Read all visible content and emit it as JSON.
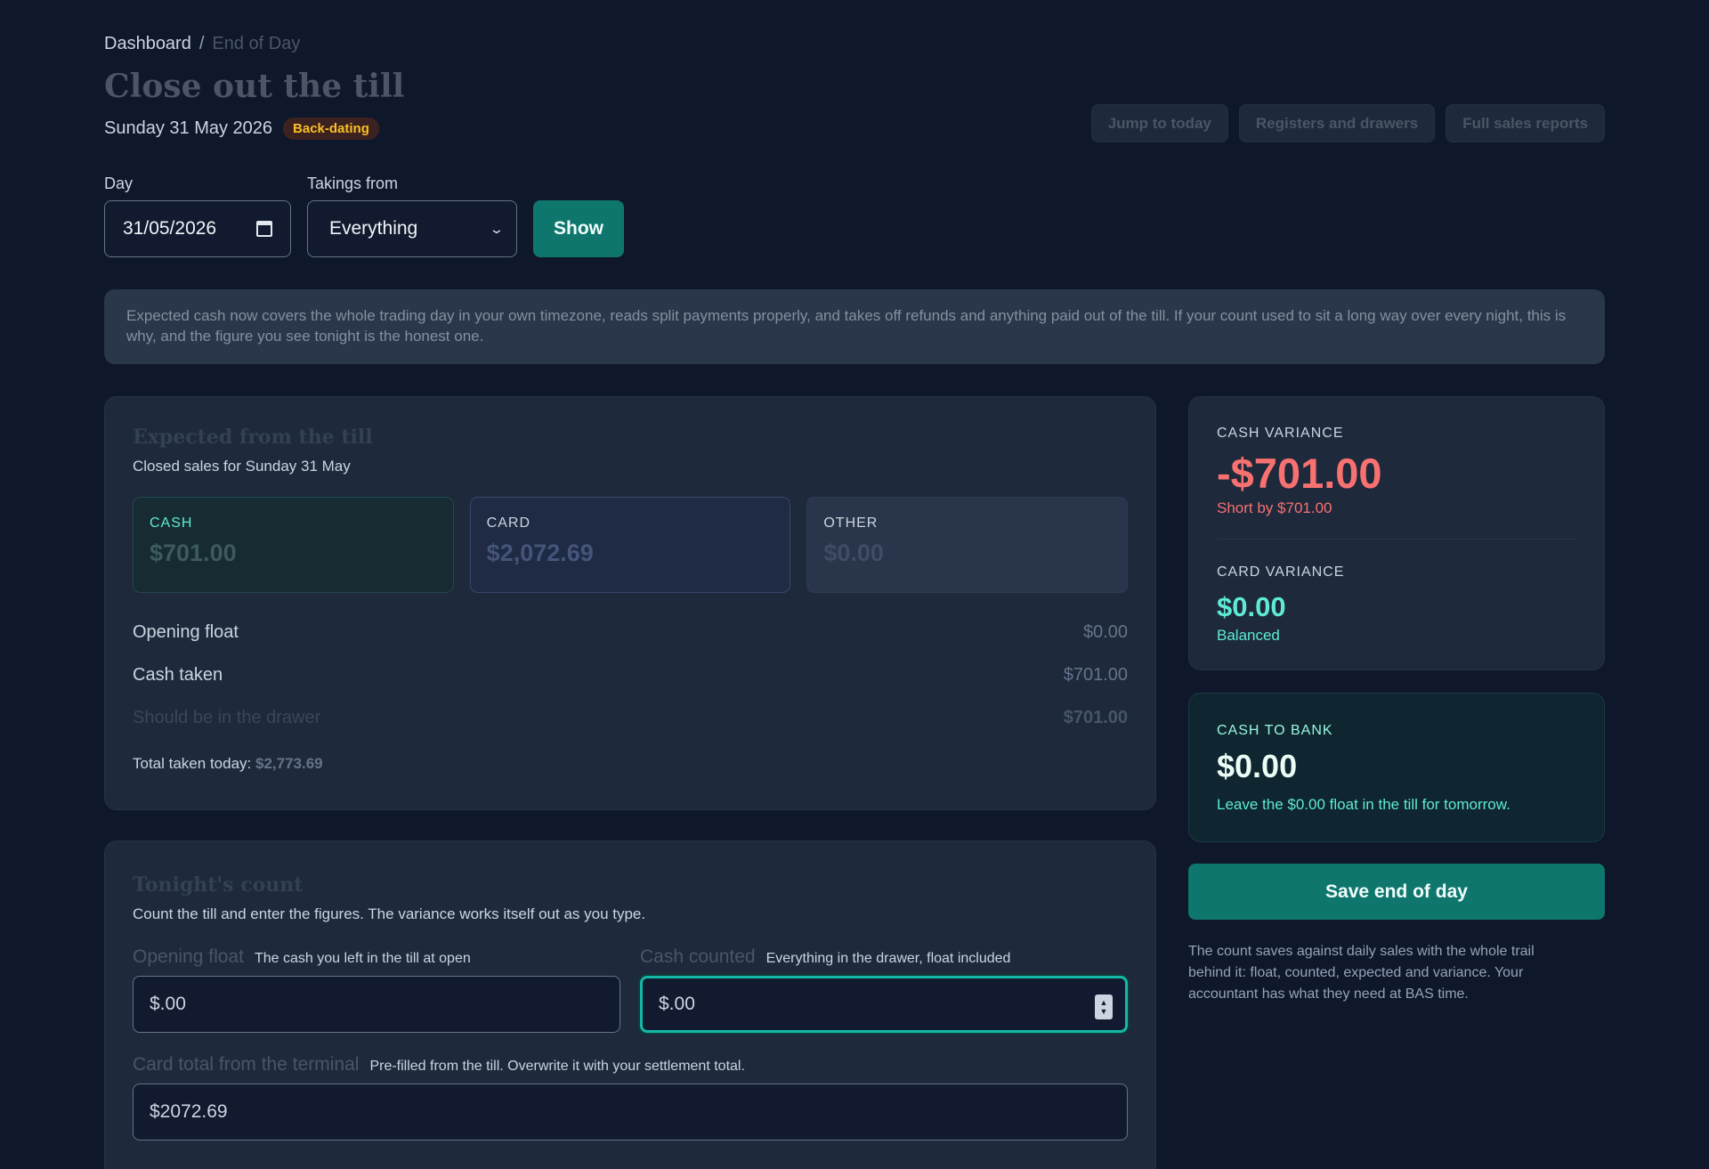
{
  "breadcrumb": {
    "root": "Dashboard",
    "separator": "/",
    "current": "End of Day"
  },
  "header": {
    "title": "Close out the till",
    "date": "Sunday 31 May 2026",
    "badge": "Back-dating",
    "actions": [
      "Jump to today",
      "Registers and drawers",
      "Full sales reports"
    ]
  },
  "filters": {
    "day_label": "Day",
    "day_value": "31/05/2026",
    "takings_label": "Takings from",
    "takings_value": "Everything",
    "show_label": "Show"
  },
  "notice": "Expected cash now covers the whole trading day in your own timezone, reads split payments properly, and takes off refunds and anything paid out of the till. If your count used to sit a long way over every night, this is why, and the figure you see tonight is the honest one.",
  "expected": {
    "title": "Expected from the till",
    "subtitle": "Closed sales for Sunday 31 May",
    "tiles": [
      {
        "label": "CASH",
        "value": "$701.00"
      },
      {
        "label": "CARD",
        "value": "$2,072.69"
      },
      {
        "label": "OTHER",
        "value": "$0.00"
      }
    ],
    "lines": [
      {
        "label": "Opening float",
        "value": "$0.00"
      },
      {
        "label": "Cash taken",
        "value": "$701.00"
      },
      {
        "label": "Should be in the drawer",
        "value": "$701.00"
      }
    ],
    "total_label": "Total taken today:",
    "total_value": "$2,773.69"
  },
  "count": {
    "title": "Tonight's count",
    "subtitle": "Count the till and enter the figures. The variance works itself out as you type.",
    "opening_float": {
      "label": "Opening float",
      "hint": "The cash you left in the till at open",
      "value": "$.00"
    },
    "cash_counted": {
      "label": "Cash counted",
      "hint": "Everything in the drawer, float included",
      "value": "$.00"
    },
    "card_total": {
      "label": "Card total from the terminal",
      "hint": "Pre-filled from the till. Overwrite it with your settlement total.",
      "value": "$2072.69"
    }
  },
  "variance": {
    "cash_label": "CASH VARIANCE",
    "cash_value": "-$701.00",
    "cash_note": "Short by $701.00",
    "card_label": "CARD VARIANCE",
    "card_value": "$0.00",
    "card_note": "Balanced"
  },
  "bank": {
    "label": "CASH TO BANK",
    "value": "$0.00",
    "note": "Leave the $0.00 float in the till for tomorrow."
  },
  "save_label": "Save end of day",
  "footnote": "The count saves against daily sales with the whole trail behind it: float, counted, expected and variance. Your accountant has what they need at BAS time.",
  "colors": {
    "accent": "#0f766e",
    "negative": "#f87171",
    "positive": "#5eead4",
    "background": "#0f172a"
  }
}
